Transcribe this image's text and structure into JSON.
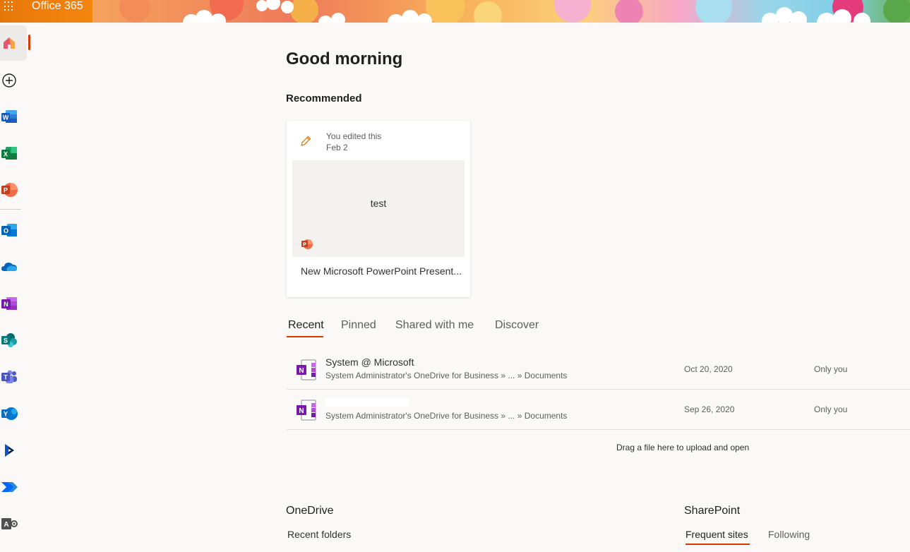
{
  "header": {
    "app_title": "Office 365",
    "waffle_icon": "app-launcher-icon"
  },
  "rail": {
    "items": [
      {
        "name": "home",
        "icon": "home-icon",
        "active": true
      },
      {
        "name": "create",
        "icon": "add-circle-icon"
      },
      {
        "name": "word",
        "icon": "word-icon",
        "color": "#185abd"
      },
      {
        "name": "excel",
        "icon": "excel-icon",
        "color": "#107c41"
      },
      {
        "name": "powerpoint",
        "icon": "powerpoint-icon",
        "color": "#c43e1c"
      },
      {
        "name": "outlook",
        "icon": "outlook-icon",
        "color": "#0078d4"
      },
      {
        "name": "onedrive",
        "icon": "onedrive-icon",
        "color": "#0364b8"
      },
      {
        "name": "onenote",
        "icon": "onenote-icon",
        "color": "#7719aa"
      },
      {
        "name": "sharepoint",
        "icon": "sharepoint-icon",
        "color": "#038387"
      },
      {
        "name": "teams",
        "icon": "teams-icon",
        "color": "#5059c9"
      },
      {
        "name": "yammer",
        "icon": "yammer-icon",
        "color": "#0078d4"
      },
      {
        "name": "dynamics",
        "icon": "dynamics-icon",
        "color": "#002050"
      },
      {
        "name": "power-automate",
        "icon": "power-automate-icon",
        "color": "#0066ff"
      },
      {
        "name": "admin",
        "icon": "admin-icon",
        "color": "#505050"
      }
    ]
  },
  "main": {
    "greeting": "Good morning",
    "recommended_title": "Recommended",
    "recommended_card": {
      "activity_line1": "You edited this",
      "activity_line2": "Feb 2",
      "thumbnail_text": "test",
      "file_name": "New Microsoft PowerPoint Present..."
    },
    "tabs": [
      {
        "label": "Recent",
        "active": true
      },
      {
        "label": "Pinned"
      },
      {
        "label": "Shared with me"
      },
      {
        "label": "Discover"
      }
    ],
    "files": [
      {
        "name": "System @ Microsoft",
        "path": "System Administrator's OneDrive for Business » ... » Documents",
        "date": "Oct 20, 2020",
        "sharing": "Only you"
      },
      {
        "name": "",
        "path": "System Administrator's OneDrive for Business » ... » Documents",
        "date": "Sep 26, 2020",
        "sharing": "Only you"
      }
    ],
    "drag_hint": "Drag a file here to upload and open",
    "onedrive": {
      "title": "OneDrive",
      "subtitle": "Recent folders"
    },
    "sharepoint": {
      "title": "SharePoint",
      "tabs": [
        {
          "label": "Frequent sites",
          "active": true
        },
        {
          "label": "Following"
        }
      ]
    }
  },
  "colors": {
    "accent": "#d83b01",
    "header_orange": "#f3860f",
    "background": "#faf9f8"
  }
}
